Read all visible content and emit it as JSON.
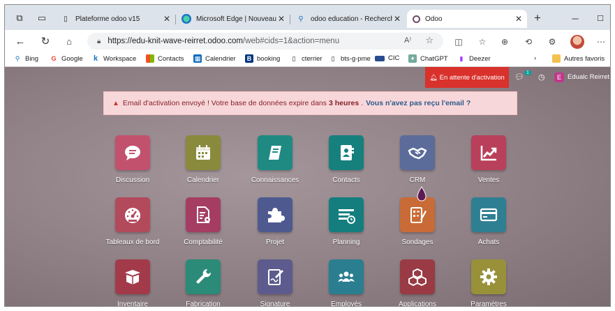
{
  "browser": {
    "tabs": [
      {
        "label": "Plateforme odoo v15",
        "icon": "document-icon"
      },
      {
        "label": "Microsoft Edge | Nouveauté",
        "icon": "edge-icon"
      },
      {
        "label": "odoo education - Recherche",
        "icon": "search-icon"
      },
      {
        "label": "Odoo",
        "icon": "odoo-icon",
        "active": true
      }
    ],
    "new_tab": "+",
    "address": {
      "base": "https://edu-knit-wave-reirret.odoo.com",
      "tail": "/web#cids=1&action=menu"
    },
    "read_aloud": "A⁾",
    "bookmarks": [
      {
        "label": "Bing",
        "icon": "search-icon"
      },
      {
        "label": "Google",
        "icon": "google-icon"
      },
      {
        "label": "Workspace",
        "icon": "workspace-icon"
      },
      {
        "label": "Contacts",
        "icon": "contacts-icon"
      },
      {
        "label": "Calendrier",
        "icon": "calendar-icon"
      },
      {
        "label": "booking",
        "icon": "booking-icon"
      },
      {
        "label": "cterrier",
        "icon": "document-icon"
      },
      {
        "label": "bts-g-pme",
        "icon": "document-icon"
      },
      {
        "label": "CIC",
        "icon": "cic-icon"
      },
      {
        "label": "ChatGPT",
        "icon": "chatgpt-icon"
      },
      {
        "label": "Deezer",
        "icon": "deezer-icon"
      },
      {
        "label": "Autres favoris",
        "icon": "folder-icon"
      }
    ]
  },
  "odoo": {
    "activation_button": "En attente d'activation",
    "message_count": "1",
    "user_initial": "E",
    "user_name": "Edualc Reirret",
    "alert": {
      "text_before": "Email d'activation envoyé ! Votre base de données expire dans",
      "hours": "3 heures",
      "text_after": ".",
      "link": "Vous n'avez pas reçu l'email ?"
    },
    "apps": [
      {
        "label": "Discussion",
        "icon": "chat-bubble-icon",
        "color": "#c2516e"
      },
      {
        "label": "Calendrier",
        "icon": "calendar-icon",
        "color": "#8a8a3c"
      },
      {
        "label": "Connaissances",
        "icon": "book-icon",
        "color": "#1e8a82"
      },
      {
        "label": "Contacts",
        "icon": "address-book-icon",
        "color": "#16807d"
      },
      {
        "label": "CRM",
        "icon": "handshake-icon",
        "color": "#5b6b9a"
      },
      {
        "label": "Ventes",
        "icon": "chart-up-icon",
        "color": "#b9405a"
      },
      {
        "label": "Tableaux de bord",
        "icon": "gauge-icon",
        "color": "#b24a5c"
      },
      {
        "label": "Comptabilité",
        "icon": "invoice-icon",
        "color": "#a53d63"
      },
      {
        "label": "Projet",
        "icon": "puzzle-icon",
        "color": "#4e5a8f"
      },
      {
        "label": "Planning",
        "icon": "planning-icon",
        "color": "#147e7e"
      },
      {
        "label": "Sondages",
        "icon": "survey-icon",
        "color": "#c96b36"
      },
      {
        "label": "Achats",
        "icon": "credit-card-icon",
        "color": "#2f7f93"
      },
      {
        "label": "Inventaire",
        "icon": "box-icon",
        "color": "#a23a4a"
      },
      {
        "label": "Fabrication",
        "icon": "wrench-icon",
        "color": "#2b8a78"
      },
      {
        "label": "Signature",
        "icon": "signature-icon",
        "color": "#5d5a8e"
      },
      {
        "label": "Employés",
        "icon": "team-icon",
        "color": "#2a7e90"
      },
      {
        "label": "Applications",
        "icon": "cubes-icon",
        "color": "#9a3a44"
      },
      {
        "label": "Paramètres",
        "icon": "gear-icon",
        "color": "#98913a"
      }
    ]
  }
}
